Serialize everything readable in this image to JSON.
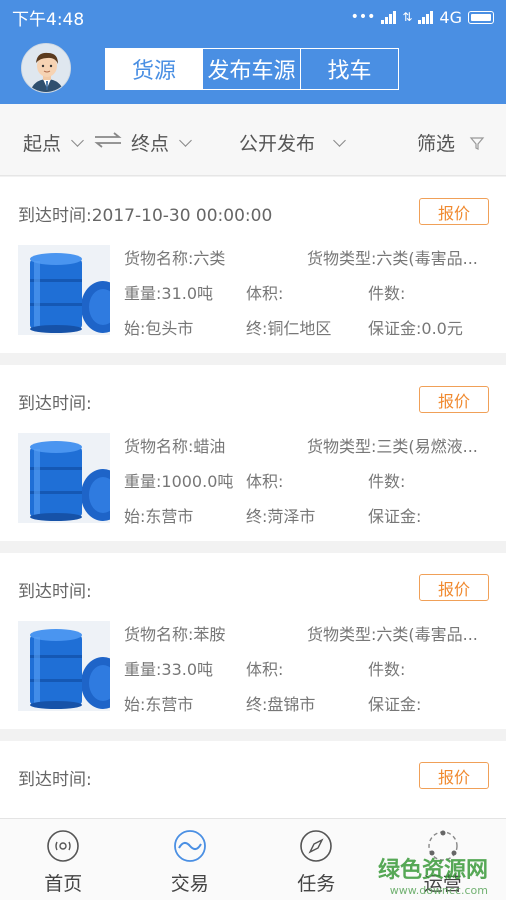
{
  "status": {
    "time": "下午4:48",
    "network": "4G"
  },
  "header": {
    "tabs": [
      {
        "label": "货源",
        "active": true
      },
      {
        "label": "发布车源",
        "active": false
      },
      {
        "label": "找车",
        "active": false
      }
    ]
  },
  "filter": {
    "origin": "起点",
    "destination": "终点",
    "publish": "公开发布",
    "screen": "筛选"
  },
  "cards": [
    {
      "arrival": "到达时间:2017-10-30 00:00:00",
      "quote": "报价",
      "cargo_name": "货物名称:六类",
      "cargo_type": "货物类型:六类(毒害品...",
      "weight": "重量:31.0吨",
      "volume": "体积:",
      "pieces": "件数:",
      "from": "始:包头市",
      "to": "终:铜仁地区",
      "deposit": "保证金:0.0元"
    },
    {
      "arrival": "到达时间:",
      "quote": "报价",
      "cargo_name": "货物名称:蜡油",
      "cargo_type": "货物类型:三类(易燃液...",
      "weight": "重量:1000.0吨",
      "volume": "体积:",
      "pieces": "件数:",
      "from": "始:东营市",
      "to": "终:菏泽市",
      "deposit": "保证金:"
    },
    {
      "arrival": "到达时间:",
      "quote": "报价",
      "cargo_name": "货物名称:苯胺",
      "cargo_type": "货物类型:六类(毒害品...",
      "weight": "重量:33.0吨",
      "volume": "体积:",
      "pieces": "件数:",
      "from": "始:东营市",
      "to": "终:盘锦市",
      "deposit": "保证金:"
    },
    {
      "arrival": "到达时间:",
      "quote": "报价"
    }
  ],
  "nav": [
    {
      "label": "首页",
      "icon": "home-icon"
    },
    {
      "label": "交易",
      "icon": "trade-icon"
    },
    {
      "label": "任务",
      "icon": "compass-icon"
    },
    {
      "label": "运营",
      "icon": "operation-icon"
    }
  ],
  "watermark": {
    "text": "绿色资源网",
    "url": "www.downcc.com"
  }
}
